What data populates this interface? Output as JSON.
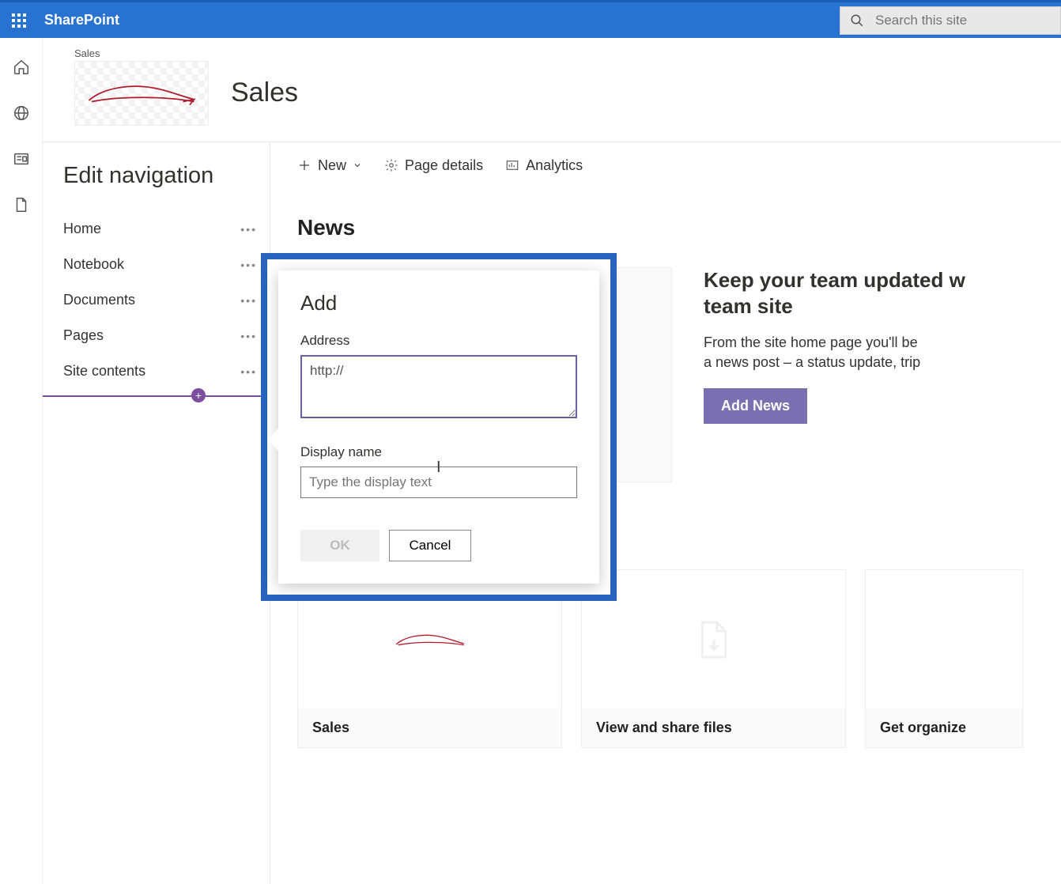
{
  "app_name": "SharePoint",
  "search": {
    "placeholder": "Search this site"
  },
  "site": {
    "crumb": "Sales",
    "title": "Sales"
  },
  "editnav": {
    "title": "Edit navigation",
    "items": [
      {
        "label": "Home"
      },
      {
        "label": "Notebook"
      },
      {
        "label": "Documents"
      },
      {
        "label": "Pages"
      },
      {
        "label": "Site contents"
      }
    ]
  },
  "commandbar": {
    "new": "New",
    "page_details": "Page details",
    "analytics": "Analytics"
  },
  "news": {
    "heading": "News",
    "promo_title": "Keep your team updated w",
    "promo_title2": "team site",
    "promo_body": "From the site home page you'll be",
    "promo_body2": "a news post – a status update, trip ",
    "add_news": "Add News"
  },
  "cards": [
    {
      "label": "Sales"
    },
    {
      "label": "View and share files"
    },
    {
      "label": "Get organize"
    }
  ],
  "dialog": {
    "title": "Add",
    "address_label": "Address",
    "address_value": "http://",
    "display_label": "Display name",
    "display_placeholder": "Type the display text",
    "ok": "OK",
    "cancel": "Cancel"
  }
}
